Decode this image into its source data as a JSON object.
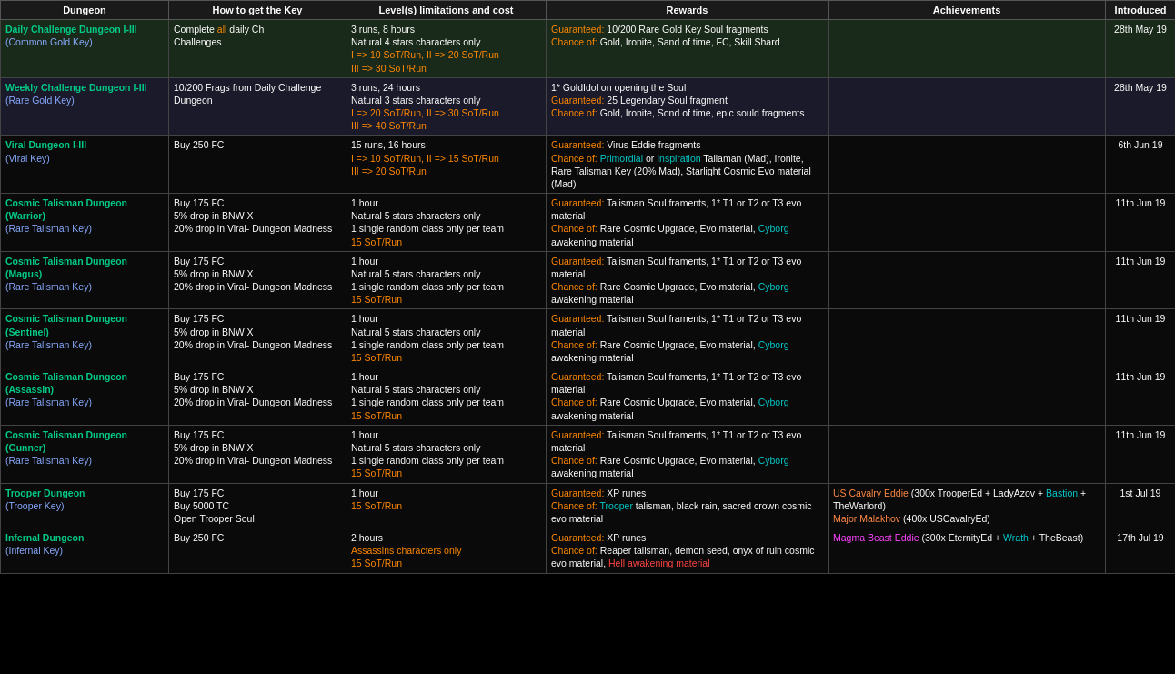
{
  "header": {
    "col_dungeon": "Dungeon",
    "col_key": "How to get the Key",
    "col_level": "Level(s) limitations and cost",
    "col_rewards": "Rewards",
    "col_achievements": "Achievements",
    "col_introduced": "Introduced"
  },
  "rows": [
    {
      "id": "daily",
      "dungeon": "Daily Challenge Dungeon I-III",
      "key": "(Common Gold Key)",
      "how_to_get": "Complete all daily Challenges",
      "level_lines": [
        {
          "text": "3 runs, 8 hours",
          "color": "white"
        },
        {
          "text": "Natural 4 stars characters only",
          "color": "white"
        },
        {
          "text": "I => 10 SoT/Run, II => 20 SoT/Run",
          "color": "orange"
        },
        {
          "text": "III => 30 SoT/Run",
          "color": "orange"
        }
      ],
      "reward_lines": [
        {
          "text": "Guaranteed: 10/200 Rare Gold Key Soul fragments",
          "parts": [
            {
              "text": "Guaranteed:",
              "color": "orange"
            },
            {
              "text": " 10/200 Rare Gold Key Soul fragments",
              "color": "white"
            }
          ]
        },
        {
          "text": "Chance of: Gold, Ironite, Sand of time, FC, Skill Shard",
          "parts": [
            {
              "text": "Chance of:",
              "color": "orange"
            },
            {
              "text": " Gold, Ironite, Sand of time, FC, Skill Shard",
              "color": "white"
            }
          ]
        }
      ],
      "achievements": "",
      "introduced": "28th May 19"
    },
    {
      "id": "weekly",
      "dungeon": "Weekly Challenge Dungeon I-III",
      "key": "(Rare Gold Key)",
      "how_to_get": "10/200 Frags from Daily Challenge Dungeon",
      "level_lines": [
        {
          "text": "3 runs, 24 hours",
          "color": "white"
        },
        {
          "text": "Natural 3 stars characters only",
          "color": "white"
        },
        {
          "text": "I => 20 SoT/Run, II => 30 SoT/Run",
          "color": "orange"
        },
        {
          "text": "III => 40 SoT/Run",
          "color": "orange"
        }
      ],
      "reward_lines": [
        {
          "parts": [
            {
              "text": "1* GoldIdol on opening the Soul",
              "color": "white"
            }
          ]
        },
        {
          "parts": [
            {
              "text": "Guaranteed:",
              "color": "orange"
            },
            {
              "text": " 25 Legendary Soul fragment",
              "color": "white"
            }
          ]
        },
        {
          "parts": [
            {
              "text": "Chance of:",
              "color": "orange"
            },
            {
              "text": " Gold, Ironite, Sond of time, epic sould fragments",
              "color": "white"
            }
          ]
        }
      ],
      "achievements": "",
      "introduced": "28th May 19"
    },
    {
      "id": "viral",
      "dungeon": "Viral Dungeon I-III",
      "key": "(Viral Key)",
      "how_to_get": "Buy 250 FC",
      "level_lines": [
        {
          "text": "15 runs, 16 hours",
          "color": "white"
        },
        {
          "text": "I => 10 SoT/Run, II => 15 SoT/Run",
          "color": "orange"
        },
        {
          "text": "III => 20 SoT/Run",
          "color": "orange"
        }
      ],
      "reward_lines": [
        {
          "parts": [
            {
              "text": "Guaranteed:",
              "color": "orange"
            },
            {
              "text": " Virus Eddie fragments",
              "color": "white"
            }
          ]
        },
        {
          "parts": [
            {
              "text": "Chance of:",
              "color": "orange"
            },
            {
              "text": " Primordial",
              "color": "cyan"
            },
            {
              "text": " or ",
              "color": "white"
            },
            {
              "text": "Inspiration",
              "color": "cyan"
            },
            {
              "text": " Taliaman (Mad), Ironite, Rare Talisman Key (20% Mad), Starlight Cosmic Evo material (Mad)",
              "color": "white"
            }
          ]
        }
      ],
      "achievements": "",
      "introduced": "6th Jun 19"
    },
    {
      "id": "cosmic_warrior",
      "dungeon": "Cosmic Talisman Dungeon (Warrior)",
      "key": "(Rare Talisman Key)",
      "how_to_get": "Buy 175 FC\n5% drop in BNW X\n20% drop in Viral- Dungeon Madness",
      "level_lines": [
        {
          "text": "1 hour",
          "color": "white"
        },
        {
          "text": "Natural 5 stars characters only",
          "color": "white"
        },
        {
          "text": "1 single random class only per team",
          "color": "white"
        },
        {
          "text": "15 SoT/Run",
          "color": "orange"
        }
      ],
      "reward_lines": [
        {
          "parts": [
            {
              "text": "Guaranteed:",
              "color": "orange"
            },
            {
              "text": " Talisman Soul framents, 1* T1 or T2 or T3 evo material",
              "color": "white"
            }
          ]
        },
        {
          "parts": [
            {
              "text": "Chance of:",
              "color": "orange"
            },
            {
              "text": " Rare Cosmic Upgrade, Evo material, ",
              "color": "white"
            },
            {
              "text": "Cyborg",
              "color": "cyan"
            },
            {
              "text": " awakening material",
              "color": "white"
            }
          ]
        }
      ],
      "achievements": "",
      "introduced": "11th Jun 19"
    },
    {
      "id": "cosmic_magus",
      "dungeon": "Cosmic Talisman Dungeon (Magus)",
      "key": "(Rare Talisman Key)",
      "how_to_get": "Buy 175 FC\n5% drop in BNW X\n20% drop in Viral- Dungeon Madness",
      "level_lines": [
        {
          "text": "1 hour",
          "color": "white"
        },
        {
          "text": "Natural 5 stars characters only",
          "color": "white"
        },
        {
          "text": "1 single random class only per team",
          "color": "white"
        },
        {
          "text": "15 SoT/Run",
          "color": "orange"
        }
      ],
      "reward_lines": [
        {
          "parts": [
            {
              "text": "Guaranteed:",
              "color": "orange"
            },
            {
              "text": " Talisman Soul framents, 1* T1 or T2 or T3 evo material",
              "color": "white"
            }
          ]
        },
        {
          "parts": [
            {
              "text": "Chance of:",
              "color": "orange"
            },
            {
              "text": " Rare Cosmic Upgrade, Evo material, ",
              "color": "white"
            },
            {
              "text": "Cyborg",
              "color": "cyan"
            },
            {
              "text": " awakening material",
              "color": "white"
            }
          ]
        }
      ],
      "achievements": "",
      "introduced": "11th Jun 19"
    },
    {
      "id": "cosmic_sentinel",
      "dungeon": "Cosmic Talisman Dungeon (Sentinel)",
      "key": "(Rare Talisman Key)",
      "how_to_get": "Buy 175 FC\n5% drop in BNW X\n20% drop in Viral- Dungeon Madness",
      "level_lines": [
        {
          "text": "1 hour",
          "color": "white"
        },
        {
          "text": "Natural 5 stars characters only",
          "color": "white"
        },
        {
          "text": "1 single random class only per team",
          "color": "white"
        },
        {
          "text": "15 SoT/Run",
          "color": "orange"
        }
      ],
      "reward_lines": [
        {
          "parts": [
            {
              "text": "Guaranteed:",
              "color": "orange"
            },
            {
              "text": " Talisman Soul framents, 1* T1 or T2 or T3 evo material",
              "color": "white"
            }
          ]
        },
        {
          "parts": [
            {
              "text": "Chance of:",
              "color": "orange"
            },
            {
              "text": " Rare Cosmic Upgrade, Evo material, ",
              "color": "white"
            },
            {
              "text": "Cyborg",
              "color": "cyan"
            },
            {
              "text": " awakening material",
              "color": "white"
            }
          ]
        }
      ],
      "achievements": "",
      "introduced": "11th Jun 19"
    },
    {
      "id": "cosmic_assassin",
      "dungeon": "Cosmic Talisman Dungeon (Assassin)",
      "key": "(Rare Talisman Key)",
      "how_to_get": "Buy 175 FC\n5% drop in BNW X\n20% drop in Viral- Dungeon Madness",
      "level_lines": [
        {
          "text": "1 hour",
          "color": "white"
        },
        {
          "text": "Natural 5 stars characters only",
          "color": "white"
        },
        {
          "text": "1 single random class only per team",
          "color": "white"
        },
        {
          "text": "15 SoT/Run",
          "color": "orange"
        }
      ],
      "reward_lines": [
        {
          "parts": [
            {
              "text": "Guaranteed:",
              "color": "orange"
            },
            {
              "text": " Talisman Soul framents, 1* T1 or T2 or T3 evo material",
              "color": "white"
            }
          ]
        },
        {
          "parts": [
            {
              "text": "Chance of:",
              "color": "orange"
            },
            {
              "text": " Rare Cosmic Upgrade, Evo material, ",
              "color": "white"
            },
            {
              "text": "Cyborg",
              "color": "cyan"
            },
            {
              "text": " awakening material",
              "color": "white"
            }
          ]
        }
      ],
      "achievements": "",
      "introduced": "11th Jun 19"
    },
    {
      "id": "cosmic_gunner",
      "dungeon": "Cosmic Talisman Dungeon (Gunner)",
      "key": "(Rare Talisman Key)",
      "how_to_get": "Buy 175 FC\n5% drop in BNW X\n20% drop in Viral- Dungeon Madness",
      "level_lines": [
        {
          "text": "1 hour",
          "color": "white"
        },
        {
          "text": "Natural 5 stars characters only",
          "color": "white"
        },
        {
          "text": "1 single random class only per team",
          "color": "white"
        },
        {
          "text": "15 SoT/Run",
          "color": "orange"
        }
      ],
      "reward_lines": [
        {
          "parts": [
            {
              "text": "Guaranteed:",
              "color": "orange"
            },
            {
              "text": " Talisman Soul framents, 1* T1 or T2 or T3 evo material",
              "color": "white"
            }
          ]
        },
        {
          "parts": [
            {
              "text": "Chance of:",
              "color": "orange"
            },
            {
              "text": " Rare Cosmic Upgrade, Evo material, ",
              "color": "white"
            },
            {
              "text": "Cyborg",
              "color": "cyan"
            },
            {
              "text": " awakening material",
              "color": "white"
            }
          ]
        }
      ],
      "achievements": "",
      "introduced": "11th Jun 19"
    },
    {
      "id": "trooper",
      "dungeon": "Trooper Dungeon",
      "key": "(Trooper Key)",
      "how_to_get": "Buy 175 FC\nBuy 5000 TC\nOpen Trooper Soul",
      "level_lines": [
        {
          "text": "1 hour",
          "color": "white"
        },
        {
          "text": "15 SoT/Run",
          "color": "orange"
        }
      ],
      "reward_lines": [
        {
          "parts": [
            {
              "text": "Guaranteed:",
              "color": "orange"
            },
            {
              "text": " XP runes",
              "color": "white"
            }
          ]
        },
        {
          "parts": [
            {
              "text": "Chance of:",
              "color": "orange"
            },
            {
              "text": " Trooper",
              "color": "cyan"
            },
            {
              "text": " talisman, black rain, sacred crown cosmic evo material",
              "color": "white"
            }
          ]
        }
      ],
      "achievements_html": true,
      "achievements": [
        {
          "text": "US Cavalry Eddie",
          "color": "#ff8844"
        },
        {
          "text": " (300x TrooperEd + LadyAzov + ",
          "color": "white"
        },
        {
          "text": "Bastion",
          "color": "cyan"
        },
        {
          "text": " + TheWarlord)",
          "color": "white"
        },
        {
          "text": "\n",
          "color": "white"
        },
        {
          "text": "Major Malakhov",
          "color": "#ff8844"
        },
        {
          "text": " (400x USCavalryEd)",
          "color": "white"
        }
      ],
      "introduced": "1st Jul 19"
    },
    {
      "id": "infernal",
      "dungeon": "Infernal Dungeon",
      "key": "(Infernal Key)",
      "how_to_get": "Buy 250 FC",
      "level_lines": [
        {
          "text": "2 hours",
          "color": "white"
        },
        {
          "text": "Assassins characters only",
          "color": "orange"
        },
        {
          "text": "15 SoT/Run",
          "color": "orange"
        }
      ],
      "reward_lines": [
        {
          "parts": [
            {
              "text": "Guaranteed:",
              "color": "orange"
            },
            {
              "text": " XP runes",
              "color": "white"
            }
          ]
        },
        {
          "parts": [
            {
              "text": "Chance of:",
              "color": "orange"
            },
            {
              "text": " Reaper talisman, demon seed, onyx of ruin cosmic evo material, ",
              "color": "white"
            },
            {
              "text": "Hell awakening material",
              "color": "#ff4444"
            }
          ]
        }
      ],
      "achievements_infernal": [
        {
          "text": "Magma Beast Eddie",
          "color": "#ff44ff"
        },
        {
          "text": " (300x EternityEd + ",
          "color": "white"
        },
        {
          "text": "Wrath",
          "color": "cyan"
        },
        {
          "text": " + TheBeast)",
          "color": "white"
        }
      ],
      "introduced": "17th Jul 19"
    }
  ]
}
